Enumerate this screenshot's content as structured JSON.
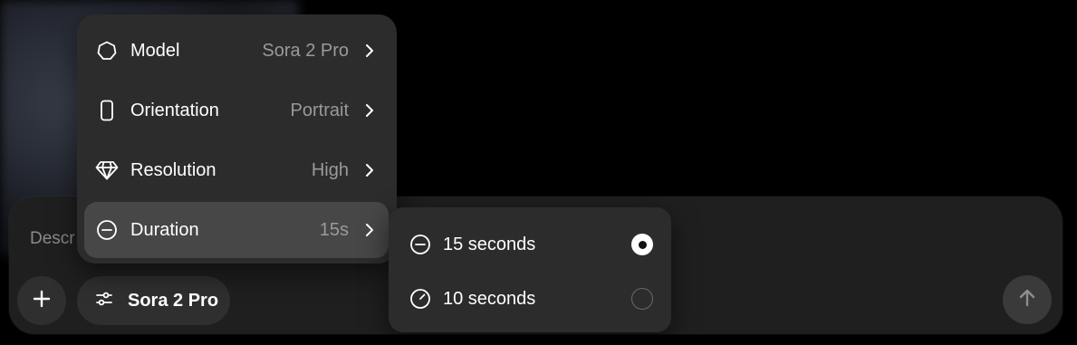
{
  "composer": {
    "placeholder": "Descr",
    "model_chip_label": "Sora 2 Pro",
    "icons": {
      "add": "plus-icon",
      "settings": "sliders-icon",
      "send": "arrow-up-icon"
    }
  },
  "settings_menu": {
    "items": [
      {
        "label": "Model",
        "value": "Sora 2 Pro",
        "icon": "model-hexagon-icon"
      },
      {
        "label": "Orientation",
        "value": "Portrait",
        "icon": "portrait-phone-icon"
      },
      {
        "label": "Resolution",
        "value": "High",
        "icon": "diamond-icon"
      },
      {
        "label": "Duration",
        "value": "15s",
        "icon": "duration-clock-icon",
        "active": true
      }
    ]
  },
  "duration_submenu": {
    "options": [
      {
        "label": "15 seconds",
        "selected": true,
        "icon": "clock-15-icon"
      },
      {
        "label": "10 seconds",
        "selected": false,
        "icon": "clock-10-icon"
      }
    ]
  },
  "colors": {
    "background": "#000000",
    "composer": "#1f1f1f",
    "menu": "#2c2c2c",
    "active_item": "#474747",
    "muted_text": "#9a9a9a"
  }
}
